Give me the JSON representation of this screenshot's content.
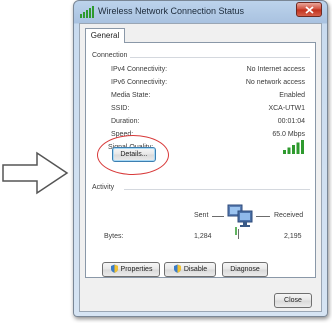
{
  "window": {
    "title": "Wireless Network Connection Status"
  },
  "tabs": [
    {
      "label": "General",
      "selected": true
    }
  ],
  "connection": {
    "group_label": "Connection",
    "rows": [
      {
        "label": "IPv4 Connectivity:",
        "value": "No Internet access"
      },
      {
        "label": "IPv6 Connectivity:",
        "value": "No network access"
      },
      {
        "label": "Media State:",
        "value": "Enabled"
      },
      {
        "label": "SSID:",
        "value": "XCA-UTW1"
      },
      {
        "label": "Duration:",
        "value": "00:01:04"
      },
      {
        "label": "Speed:",
        "value": "65.0 Mbps"
      }
    ],
    "signal_quality_label": "Signal Quality:",
    "signal_bars": 5,
    "details_button": "Details..."
  },
  "activity": {
    "group_label": "Activity",
    "sent_label": "Sent",
    "received_label": "Received",
    "bytes_label": "Bytes:",
    "bytes_sent": "1,284",
    "bytes_received": "2,195"
  },
  "buttons": {
    "properties": "Properties",
    "disable": "Disable",
    "diagnose": "Diagnose",
    "close": "Close"
  },
  "colors": {
    "highlight_ellipse": "#d83a3a",
    "signal_green": "#2e9a2e",
    "title_bar": "#bcd3ec"
  }
}
